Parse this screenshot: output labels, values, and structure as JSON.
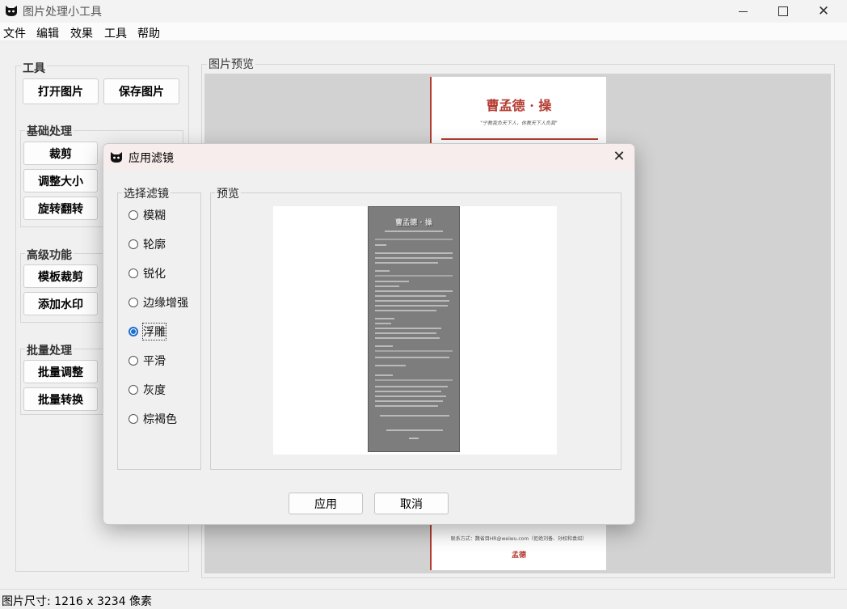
{
  "window": {
    "title": "图片处理小工具",
    "icon": "cat-logo-icon"
  },
  "menu": [
    "文件",
    "编辑",
    "效果",
    "工具",
    "帮助"
  ],
  "tools": {
    "group_title": "工具",
    "open_label": "打开图片",
    "save_label": "保存图片",
    "basic": {
      "title": "基础处理",
      "buttons": [
        "裁剪",
        "调整大小",
        "旋转翻转"
      ]
    },
    "advanced": {
      "title": "高级功能",
      "buttons": [
        "模板裁剪",
        "添加水印"
      ]
    },
    "batch": {
      "title": "批量处理",
      "buttons": [
        "批量调整",
        "批量转换"
      ]
    }
  },
  "preview": {
    "title": "图片预览",
    "document": {
      "heading": "曹孟德 · 操",
      "motto": "\"宁教我负天下人，休教天下人负我\"",
      "contact": "联系方式：魏省目HR@weiwu.com（拒绝刘备、孙权和袁绍）",
      "signature": "孟德"
    }
  },
  "status": {
    "text": "图片尺寸: 1216 x 3234 像素"
  },
  "dialog": {
    "title": "应用滤镜",
    "filters_title": "选择滤镜",
    "filters": [
      "模糊",
      "轮廓",
      "锐化",
      "边缘增强",
      "浮雕",
      "平滑",
      "灰度",
      "棕褐色"
    ],
    "selected_filter": "浮雕",
    "preview_title": "预览",
    "preview_heading": "曹孟德 · 操",
    "apply_label": "应用",
    "cancel_label": "取消"
  },
  "colors": {
    "accent": "#1f6fcf",
    "document_red": "#b33b30",
    "dialog_titlebar": "#f7eded"
  }
}
